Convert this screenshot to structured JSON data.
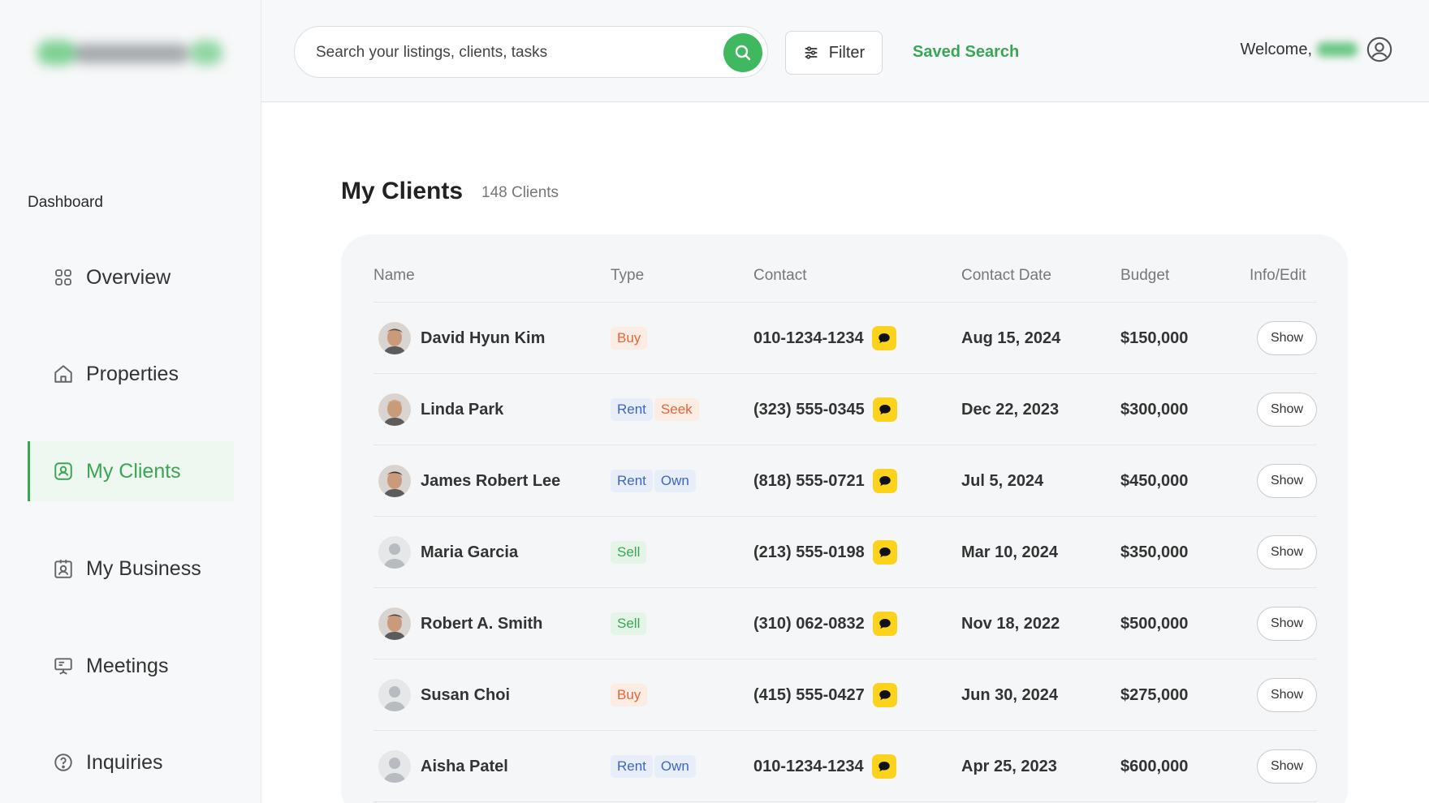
{
  "sidebar": {
    "section_label": "Dashboard",
    "items": [
      {
        "label": "Overview",
        "icon": "grid-icon",
        "active": false
      },
      {
        "label": "Properties",
        "icon": "home-icon",
        "active": false
      },
      {
        "label": "My Clients",
        "icon": "clients-icon",
        "active": true
      },
      {
        "label": "My Business",
        "icon": "business-icon",
        "active": false
      },
      {
        "label": "Meetings",
        "icon": "presentation-icon",
        "active": false
      },
      {
        "label": "Inquiries",
        "icon": "question-icon",
        "active": false
      }
    ]
  },
  "header": {
    "search_placeholder": "Search your listings, clients, tasks",
    "filter_label": "Filter",
    "saved_search_label": "Saved Search",
    "welcome_label": "Welcome,",
    "accent_color": "#3fb85f"
  },
  "main": {
    "title": "My Clients",
    "count": "148 Clients",
    "columns": [
      "Name",
      "Type",
      "Contact",
      "Contact Date",
      "Budget",
      "Info/Edit"
    ],
    "rows": [
      {
        "name": "David Hyun Kim",
        "tags": [
          "Buy"
        ],
        "contact": "010-1234-1234",
        "date": "Aug 15, 2024",
        "budget": "$150,000",
        "action": "Show",
        "avatar": "photo"
      },
      {
        "name": "Linda Park",
        "tags": [
          "Rent",
          "Seek"
        ],
        "contact": "(323) 555-0345",
        "date": "Dec 22, 2023",
        "budget": "$300,000",
        "action": "Show",
        "avatar": "photo"
      },
      {
        "name": "James Robert Lee",
        "tags": [
          "Rent",
          "Own"
        ],
        "contact": "(818) 555-0721",
        "date": "Jul 5, 2024",
        "budget": "$450,000",
        "action": "Show",
        "avatar": "photo"
      },
      {
        "name": "Maria Garcia",
        "tags": [
          "Sell"
        ],
        "contact": "(213) 555-0198",
        "date": "Mar 10, 2024",
        "budget": "$350,000",
        "action": "Show",
        "avatar": "placeholder"
      },
      {
        "name": "Robert A. Smith",
        "tags": [
          "Sell"
        ],
        "contact": "(310) 062-0832",
        "date": "Nov 18, 2022",
        "budget": "$500,000",
        "action": "Show",
        "avatar": "photo"
      },
      {
        "name": "Susan Choi",
        "tags": [
          "Buy"
        ],
        "contact": "(415) 555-0427",
        "date": "Jun 30, 2024",
        "budget": "$275,000",
        "action": "Show",
        "avatar": "placeholder"
      },
      {
        "name": "Aisha Patel",
        "tags": [
          "Rent",
          "Own"
        ],
        "contact": "010-1234-1234",
        "date": "Apr 25, 2023",
        "budget": "$600,000",
        "action": "Show",
        "avatar": "placeholder"
      }
    ]
  }
}
